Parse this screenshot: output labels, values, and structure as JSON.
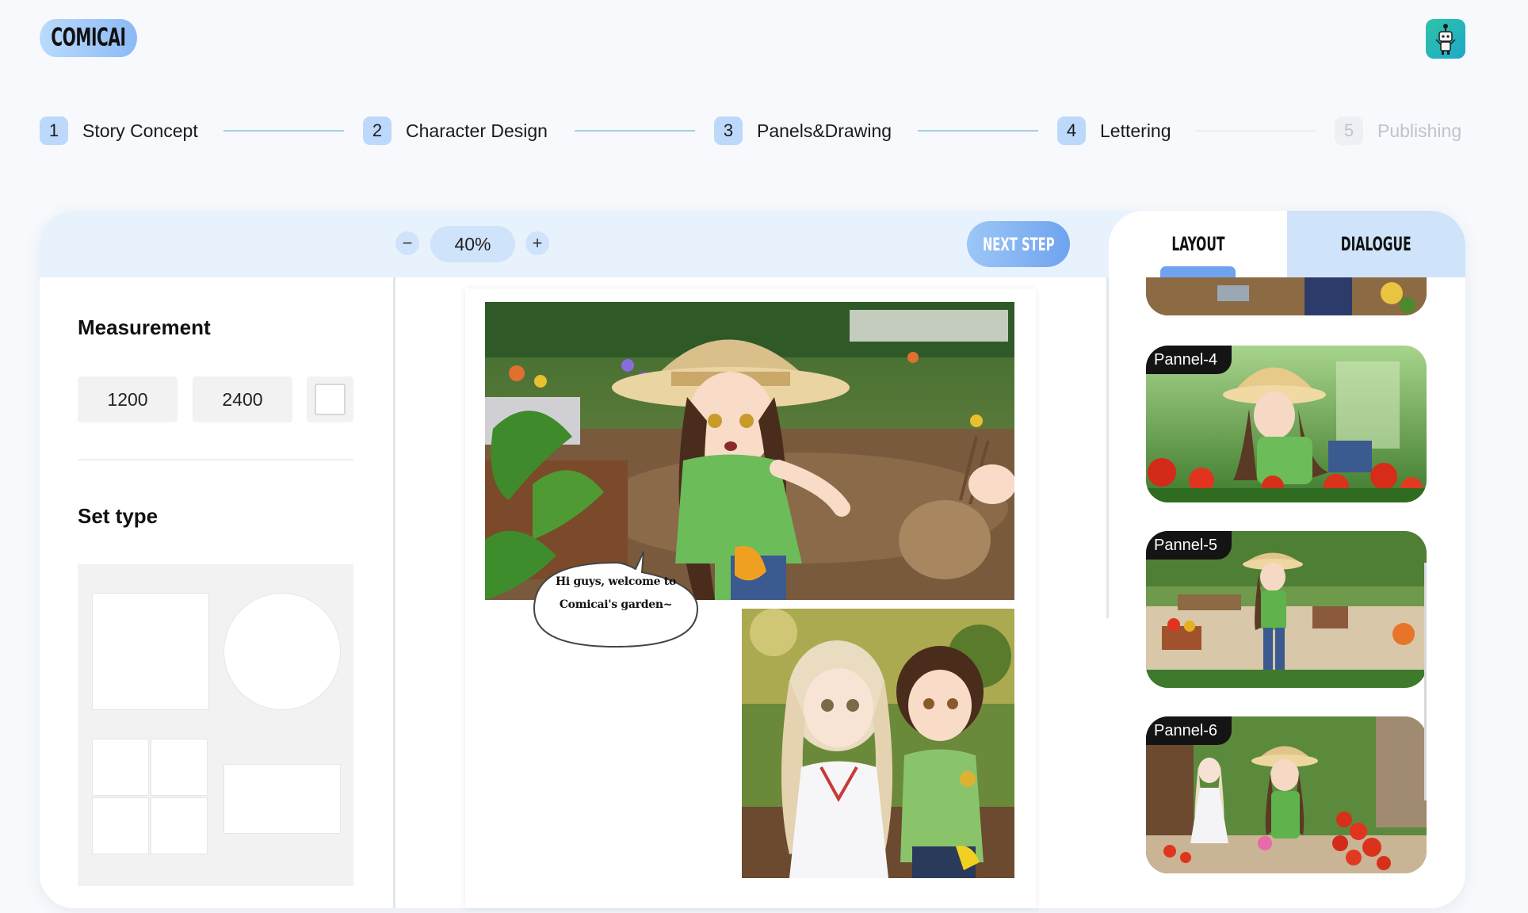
{
  "app": {
    "logo": "COMICAI"
  },
  "stepper": {
    "steps": [
      {
        "num": "1",
        "label": "Story Concept",
        "state": "done"
      },
      {
        "num": "2",
        "label": "Character Design",
        "state": "done"
      },
      {
        "num": "3",
        "label": "Panels&Drawing",
        "state": "active"
      },
      {
        "num": "4",
        "label": "Lettering",
        "state": "done"
      },
      {
        "num": "5",
        "label": "Publishing",
        "state": "disabled"
      }
    ]
  },
  "toolbar": {
    "zoom_minus": "−",
    "zoom_value": "40%",
    "zoom_plus": "+",
    "next_step": "NEXT STEP"
  },
  "tabs": {
    "layout": "LAYOUT",
    "dialogue": "DIALOGUE"
  },
  "sidebar": {
    "measurement_title": "Measurement",
    "width": "1200",
    "height": "2400",
    "set_type_title": "Set type"
  },
  "canvas": {
    "bubble_line1": "Hi guys, welcome to",
    "bubble_line2": "Comicai's garden~"
  },
  "panels": [
    {
      "label": "Pannel-4"
    },
    {
      "label": "Pannel-5"
    },
    {
      "label": "Pannel-6"
    }
  ],
  "colors": {
    "accent": "#6fa3ef",
    "accent_light": "#cfe3fb",
    "step_badge": "#bcd9fb",
    "topbar": "#e8f2fd"
  }
}
